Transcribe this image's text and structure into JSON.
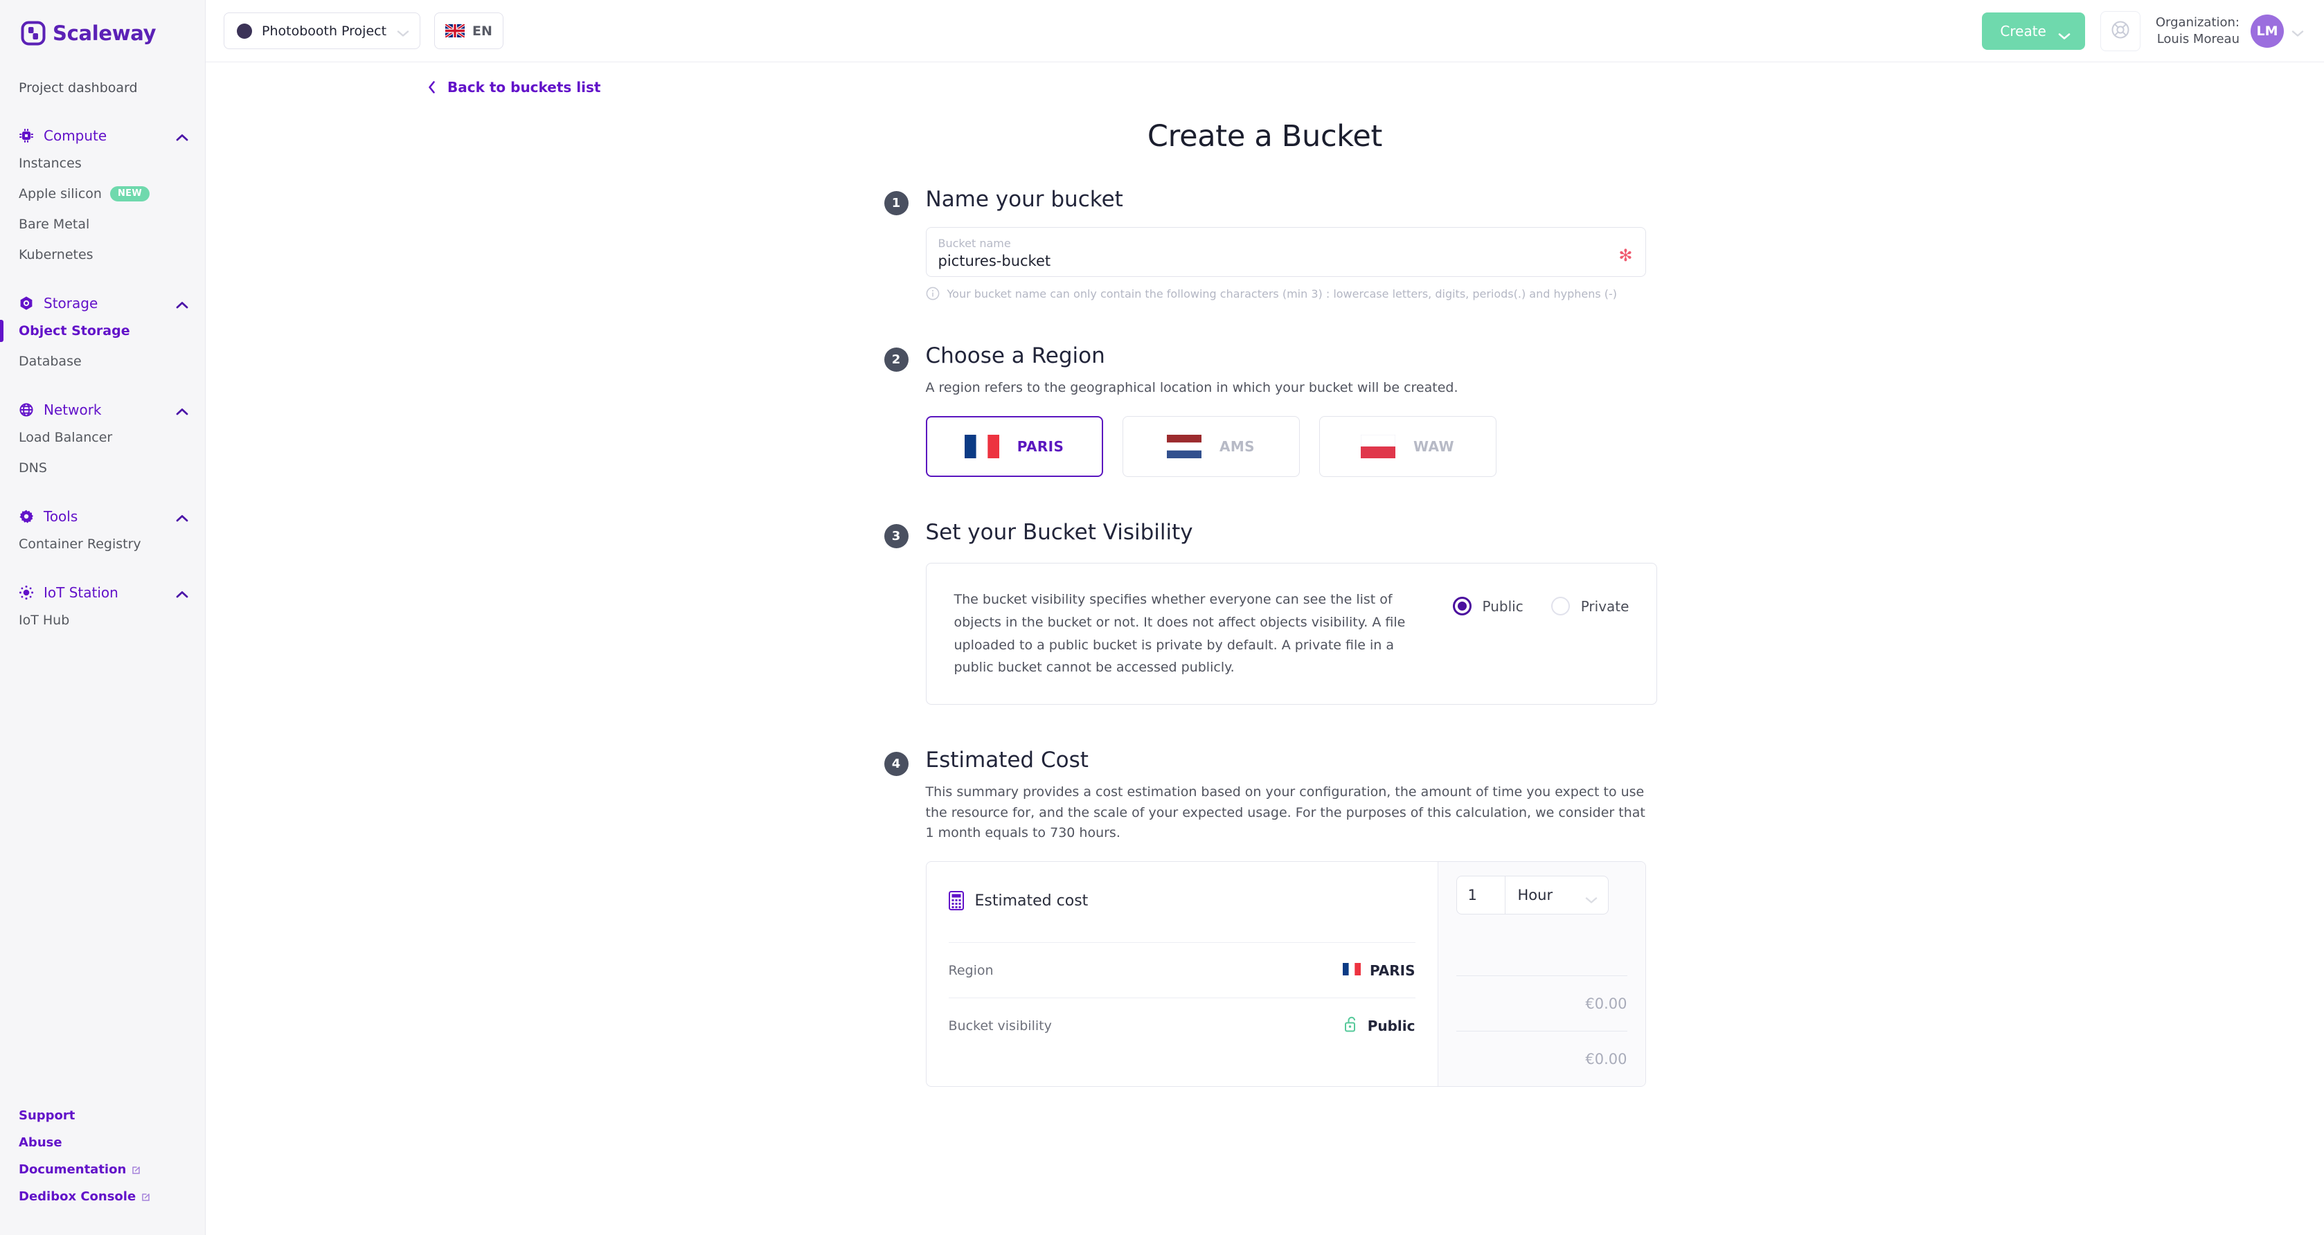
{
  "brand": {
    "name": "Scaleway",
    "accent": "#6212c9",
    "green": "#6fd9ad"
  },
  "topbar": {
    "project": {
      "name": "Photobooth Project",
      "dot_color": "#3b3257"
    },
    "language": {
      "code": "EN",
      "flag": "uk-flag-icon"
    },
    "create_button": "Create",
    "help_icon": "lifebuoy-icon",
    "organization_label": "Organization:",
    "organization_name": "Louis Moreau",
    "avatar_initials": "LM"
  },
  "sidebar": {
    "dashboard_label": "Project dashboard",
    "groups": [
      {
        "title": "Compute",
        "icon": "cpu-icon",
        "items": [
          {
            "label": "Instances",
            "badge": ""
          },
          {
            "label": "Apple silicon",
            "badge": "NEW"
          },
          {
            "label": "Bare Metal",
            "badge": ""
          },
          {
            "label": "Kubernetes",
            "badge": ""
          }
        ]
      },
      {
        "title": "Storage",
        "icon": "storage-hex-icon",
        "items": [
          {
            "label": "Object Storage",
            "badge": "",
            "active": true
          },
          {
            "label": "Database",
            "badge": ""
          }
        ]
      },
      {
        "title": "Network",
        "icon": "globe-icon",
        "items": [
          {
            "label": "Load Balancer",
            "badge": ""
          },
          {
            "label": "DNS",
            "badge": ""
          }
        ]
      },
      {
        "title": "Tools",
        "icon": "gear-icon",
        "items": [
          {
            "label": "Container Registry",
            "badge": ""
          }
        ]
      },
      {
        "title": "IoT Station",
        "icon": "iot-dots-icon",
        "items": [
          {
            "label": "IoT Hub",
            "badge": ""
          }
        ]
      }
    ],
    "footer_links": [
      {
        "label": "Support",
        "external": false
      },
      {
        "label": "Abuse",
        "external": false
      },
      {
        "label": "Documentation",
        "external": true
      },
      {
        "label": "Dedibox Console",
        "external": true
      }
    ]
  },
  "page": {
    "back_link": "Back to buckets list",
    "title": "Create a Bucket"
  },
  "step1": {
    "number": "1",
    "title": "Name your bucket",
    "field_label": "Bucket name",
    "field_value": "pictures-bucket",
    "required_mark": "✻",
    "hint": "Your bucket name can only contain the following characters (min 3) : lowercase letters, digits, periods(.) and hyphens (-)"
  },
  "step2": {
    "number": "2",
    "title": "Choose a Region",
    "description": "A region refers to the geographical location in which your bucket will be created.",
    "regions": [
      {
        "code": "PARIS",
        "flag": "fr-flag-icon",
        "selected": true
      },
      {
        "code": "AMS",
        "flag": "nl-flag-icon",
        "selected": false
      },
      {
        "code": "WAW",
        "flag": "pl-flag-icon",
        "selected": false
      }
    ]
  },
  "step3": {
    "number": "3",
    "title": "Set your Bucket Visibility",
    "description": "The bucket visibility specifies whether everyone can see the list of objects in the bucket or not. It does not affect objects visibility. A file uploaded to a public bucket is private by default. A private file in a public bucket cannot be accessed publicly.",
    "options": [
      {
        "label": "Public",
        "selected": true
      },
      {
        "label": "Private",
        "selected": false
      }
    ]
  },
  "step4": {
    "number": "4",
    "title": "Estimated Cost",
    "description": "This summary provides a cost estimation based on your configuration, the amount of time you expect to use the resource for, and the scale of your expected usage. For the purposes of this calculation, we consider that 1 month equals to 730 hours.",
    "panel": {
      "heading": "Estimated cost",
      "heading_icon": "calculator-icon",
      "quantity": "1",
      "unit": "Hour",
      "rows": [
        {
          "key": "Region",
          "value": "PARIS",
          "icon": "fr-flag-icon",
          "price": "€0.00"
        },
        {
          "key": "Bucket visibility",
          "value": "Public",
          "icon": "open-lock-icon",
          "price": "€0.00"
        }
      ]
    }
  }
}
